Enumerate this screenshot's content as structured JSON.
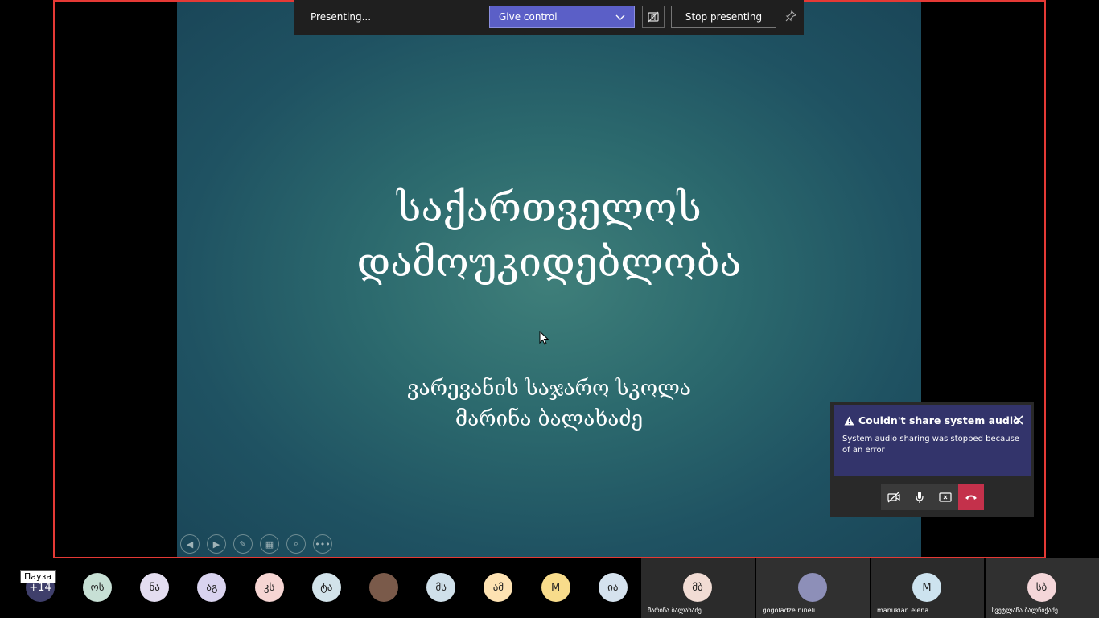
{
  "toolbar": {
    "status": "Presenting...",
    "give_control": "Give control",
    "stop_presenting": "Stop presenting"
  },
  "slide": {
    "title_line1": "საქართველოს",
    "title_line2": "დამოუკიდებლობა",
    "subtitle_line1": "ვარევანის საჯარო სკოლა",
    "subtitle_line2": "მარინა ბალახაძე"
  },
  "toast": {
    "title": "Couldn't share system audio",
    "message": "System audio sharing was stopped because of an error"
  },
  "tooltip": {
    "pause": "Пауза"
  },
  "participants": {
    "more": "+14",
    "avatars": [
      {
        "initials": "ოს",
        "color": "#c7e0d5"
      },
      {
        "initials": "ნა",
        "color": "#e3ddf0"
      },
      {
        "initials": "აგ",
        "color": "#d9d3ef"
      },
      {
        "initials": "კს",
        "color": "#f6d5d3"
      },
      {
        "initials": "ტა",
        "color": "#d2e3ea"
      },
      {
        "initials": "",
        "color": "#7a5a4a"
      },
      {
        "initials": "მს",
        "color": "#cfe0ea"
      },
      {
        "initials": "ამ",
        "color": "#fde2b2"
      },
      {
        "initials": "M",
        "color": "#f8dc8b"
      },
      {
        "initials": "ია",
        "color": "#d5e2ee"
      }
    ],
    "tiles": [
      {
        "initials": "მბ",
        "name": "მარინა ბალახაძე",
        "color": "#f1dcd4",
        "bg": "#2b2b2b"
      },
      {
        "initials": "",
        "name": "gogoladze.nineli",
        "color": "#8d8fb8",
        "bg": "#303030"
      },
      {
        "initials": "M",
        "name": "manukian.elena",
        "color": "#cde3ef",
        "bg": "#2b2b2b"
      },
      {
        "initials": "სბ",
        "name": "სვეტლანა ბალნიქაძე",
        "color": "#f4d6d9",
        "bg": "#303030"
      }
    ]
  }
}
